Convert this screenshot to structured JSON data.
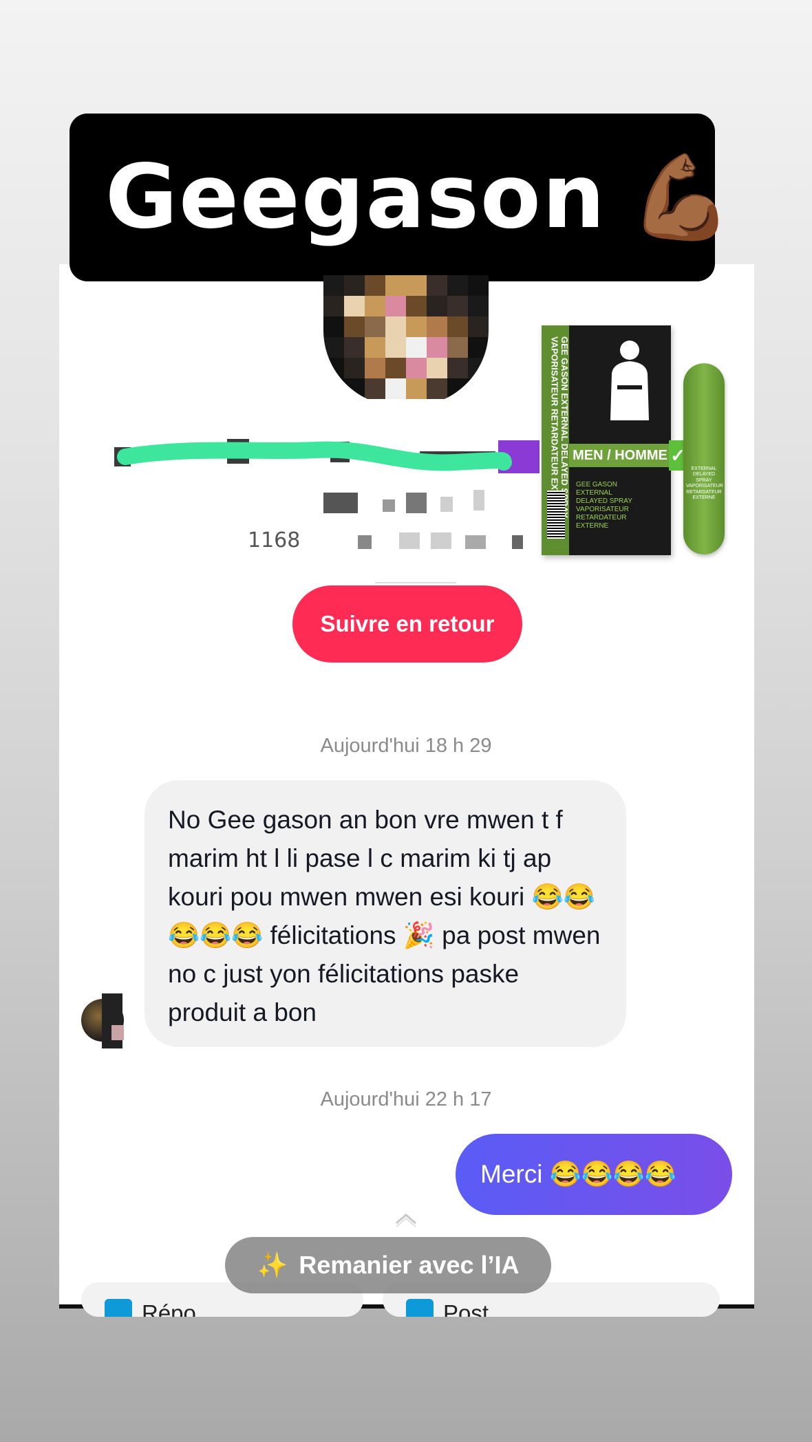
{
  "overlay_title": {
    "text": "Geegason",
    "emoji": "💪🏾"
  },
  "profile": {
    "stat_partial": "1168"
  },
  "product": {
    "brand_side": "GEE GASON EXTERNAL DELAYED SPRAY VAPORISATEUR RETARDATEUR EXTERNE",
    "band_label": "MEN / HOMME",
    "front_small": "GEE GASON EXTERNAL DELAYED SPRAY VAPORISATEUR RETARDATEUR EXTERNE",
    "spray_label": "EXTERNAL DELAYED SPRAY VAPORISATEUR RETARDATEUR EXTERNE",
    "check_glyph": "✓"
  },
  "follow_button": {
    "label": "Suivre en retour"
  },
  "chat": {
    "timestamp_1": "Aujourd'hui 18 h 29",
    "received_message": "No Gee gason an bon vre mwen t f marim ht l li pase l c marim ki tj ap kouri pou mwen mwen esi kouri 😂😂😂😂😂 félicitations 🎉 pa post mwen no c just yon félicitations paske produit a bon",
    "timestamp_2": "Aujourd'hui 22 h 17",
    "sent_message": "Merci 😂😂😂😂"
  },
  "ai_button": {
    "label": "Remanier avec l’IA",
    "icon": "sparkle-icon",
    "glyph": "✨"
  },
  "suggestions": [
    {
      "label": "Répo"
    },
    {
      "label": "Post"
    }
  ],
  "colors": {
    "follow": "#fe2c55",
    "sent_bubble_start": "#5a5cf6",
    "sent_bubble_end": "#7a4ee8",
    "received_bubble": "#f1f1f2",
    "scribble": "#3ee59c",
    "product_green": "#6fa23a"
  }
}
